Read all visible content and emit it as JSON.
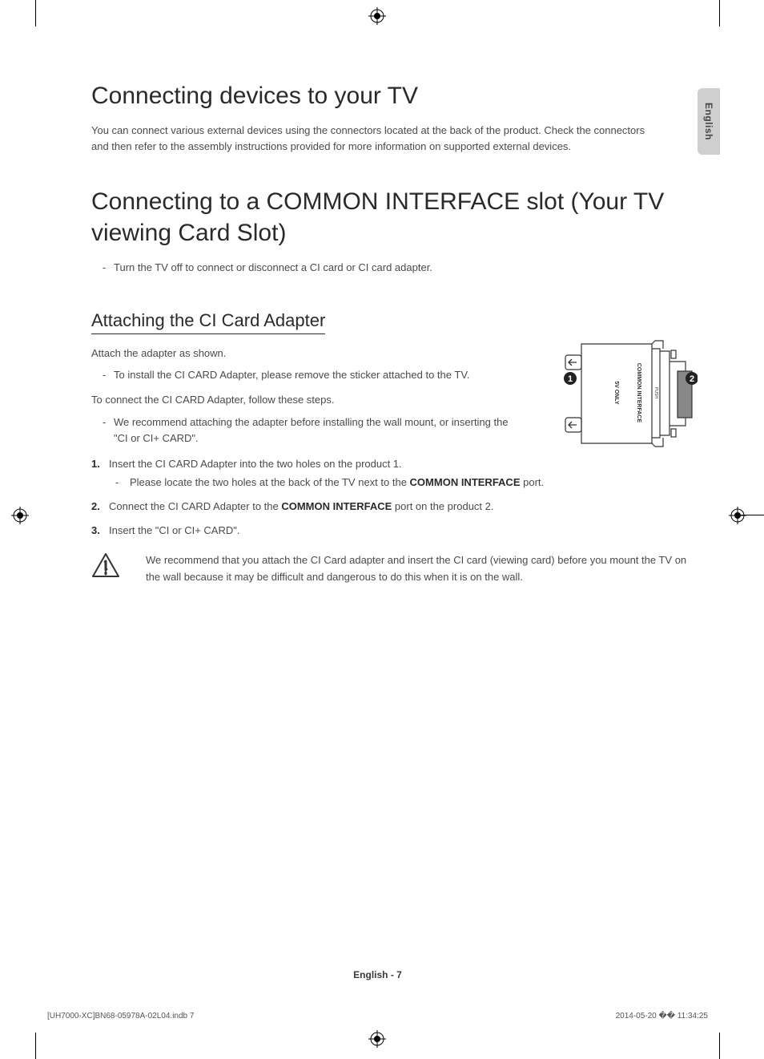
{
  "side_tab": "English",
  "heading1": "Connecting devices to your TV",
  "intro": "You can connect various external devices using the connectors located at the back of the product. Check the connectors and then refer to the assembly instructions provided for more information on supported external devices.",
  "heading2": "Connecting to a COMMON INTERFACE slot (Your TV viewing Card Slot)",
  "h2_bullet": "Turn the TV off to connect or disconnect a CI card or CI card adapter.",
  "subhead": "Attaching the CI Card Adapter",
  "attach_intro": "Attach the adapter as shown.",
  "attach_bullet": "To install the CI CARD Adapter, please remove the sticker attached to the TV.",
  "connect_intro": "To connect the CI CARD Adapter, follow these steps.",
  "connect_bullet": "We recommend attaching the adapter before installing the wall mount, or inserting the \"CI or CI+ CARD\".",
  "steps": {
    "s1_text": "Insert the CI CARD Adapter into the two holes on the product 1.",
    "s1_sub_a": "Please locate the two holes at the back of the TV next to the ",
    "s1_sub_bold": "COMMON INTERFACE",
    "s1_sub_b": " port.",
    "s2_a": "Connect the CI CARD Adapter to the ",
    "s2_bold": "COMMON INTERFACE",
    "s2_b": " port on the product 2.",
    "s3": "Insert the \"CI or CI+ CARD\"."
  },
  "caution": "We recommend that you attach the CI Card adapter and insert the CI card (viewing card) before you mount the TV on the wall because it may be difficult and dangerous to do this when it is on the wall.",
  "diagram_labels": {
    "common_interface": "COMMON INTERFACE",
    "sv_only": "5V ONLY",
    "push": "PUSH",
    "marker1": "1",
    "marker2": "2"
  },
  "footer_center": "English - 7",
  "doc_footer_left": "[UH7000-XC]BN68-05978A-02L04.indb   7",
  "doc_footer_right": "2014-05-20   �� 11:34:25"
}
